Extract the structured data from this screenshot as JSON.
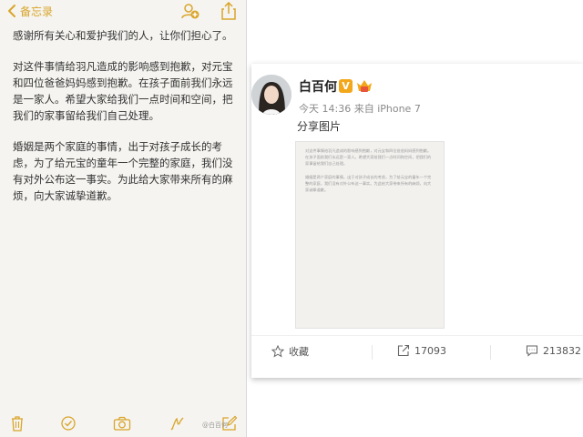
{
  "notes": {
    "back_label": "备忘录",
    "paragraphs": [
      "感谢所有关心和爱护我们的人，让你们担心了。",
      "对这件事情给羽凡造成的影响感到抱歉，对元宝和四位爸爸妈妈感到抱歉。在孩子面前我们永远是一家人。希望大家给我们一点时间和空间，把我们的家事留给我们自己处理。",
      "婚姻是两个家庭的事情，出于对孩子成长的考虑，为了给元宝的童年一个完整的家庭，我们没有对外公布这一事实。为此给大家带来所有的麻烦，向大家诚挚道歉。"
    ],
    "accent_color": "#d9a52b",
    "icons": {
      "back": "chevron-left-icon",
      "add_person": "add-person-icon",
      "share": "share-icon",
      "trash": "trash-icon",
      "checklist": "checklist-icon",
      "camera": "camera-icon",
      "sketch": "sketch-icon",
      "compose": "compose-icon"
    }
  },
  "weibo": {
    "username": "白百何",
    "verified_badge": "V",
    "meta": "今天 14:36 来自 iPhone 7",
    "post_text": "分享图片",
    "image_paragraphs": [
      "对这件事情给羽凡造成的影响感到抱歉，对元宝和四位爸爸妈妈感到抱歉。在孩子面前我们永远是一家人。希望大家给我们一点时间和空间，把我们的家事留给我们自己处理。",
      "婚姻是两个家庭的事情，出于对孩子成长的考虑，为了给元宝的童年一个完整的家庭，我们没有对外公布这一事实。为此给大家带来所有的麻烦，向大家诚挚道歉。"
    ],
    "actions": {
      "favorite_label": "收藏",
      "repost_count": "17093",
      "comment_count": "213832"
    },
    "badge_color": "#f3a71a"
  },
  "watermark": "@白百何"
}
